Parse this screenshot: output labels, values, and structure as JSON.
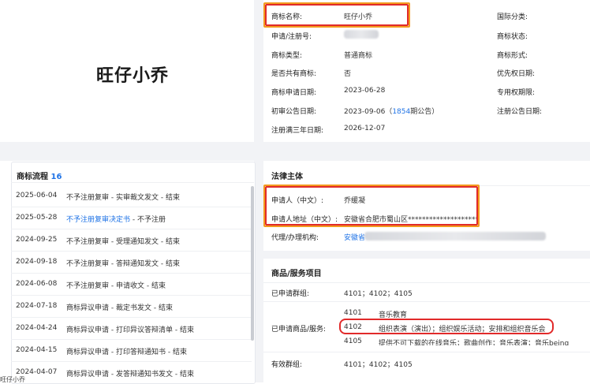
{
  "trademark": {
    "logo_text": "旺仔小乔",
    "fields": [
      {
        "label": "商标名称:",
        "value": "旺仔小乔"
      },
      {
        "label": "申请/注册号:",
        "value": ""
      },
      {
        "label": "商标类型:",
        "value": "普通商标"
      },
      {
        "label": "是否共有商标:",
        "value": "否"
      },
      {
        "label": "商标申请日期:",
        "value": "2023-06-28"
      },
      {
        "label": "初审公告日期:",
        "value_prefix": "2023-09-06（",
        "value_link": "1854",
        "value_suffix": "期公告）"
      },
      {
        "label": "注册满三年日期:",
        "value": "2026-12-07"
      }
    ],
    "right_fields": [
      "国际分类:",
      "商标状态:",
      "商标形式:",
      "优先权日期:",
      "专用权期限:",
      "注册公告日期:"
    ]
  },
  "flow": {
    "title": "商标流程",
    "count": "16",
    "items": [
      {
        "date": "2025-06-04",
        "desc": "不予注册复审 - 实审裁文发文 - 结束",
        "link": false
      },
      {
        "date": "2025-05-28",
        "desc": "不予注册复审决定书",
        "suffix": " - 不予注册",
        "link": true
      },
      {
        "date": "2024-09-25",
        "desc": "不予注册复审 - 受理通知发文 - 结束",
        "link": false
      },
      {
        "date": "2024-09-18",
        "desc": "不予注册复审 - 答辩通知发文 - 结束",
        "link": false
      },
      {
        "date": "2024-06-08",
        "desc": "不予注册复审 - 申请收文 - 结束",
        "link": false
      },
      {
        "date": "2024-07-18",
        "desc": "商标异议申请 - 裁定书发文 - 结束",
        "link": false
      },
      {
        "date": "2024-04-24",
        "desc": "商标异议申请 - 打印异议答辩清单 - 结束",
        "link": false
      },
      {
        "date": "2024-04-15",
        "desc": "商标异议申请 - 打印答辩通知书 - 结束",
        "link": false
      },
      {
        "date": "2024-04-07",
        "desc": "商标异议申请 - 发答辩通知书发文 - 结束",
        "link": false
      }
    ]
  },
  "legal": {
    "title": "法律主体",
    "applicant_label": "申请人（中文）:",
    "applicant_value": "乔缓凝",
    "address_label": "申请人地址（中文）:",
    "address_value": "安徽省合肥市蜀山区********************",
    "agent_label": "代理/办理机构:",
    "agent_value": "安徽省"
  },
  "goods": {
    "title": "商品/服务项目",
    "groups_label": "已申请群组:",
    "groups_value": "4101；4102；4105",
    "items_label": "已申请商品/服务:",
    "items": [
      {
        "code": "4101",
        "desc": "音乐教育"
      },
      {
        "code": "4102",
        "desc": "组织表演（演出）；组织娱乐活动；安排和组织音乐会"
      },
      {
        "code": "4105",
        "desc": "提供不可下载的在线音乐；歌曲创作；音乐表演；音乐being"
      }
    ],
    "valid_groups_label": "有效群组:",
    "valid_groups_value": "4101；4102；4105"
  },
  "footer_text": "旺仔小乔"
}
